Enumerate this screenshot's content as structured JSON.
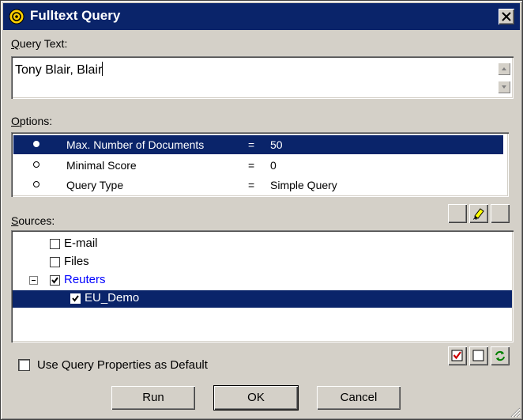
{
  "window": {
    "title": "Fulltext Query"
  },
  "query_text": {
    "label": "Query Text:",
    "value": "Tony Blair, Blair"
  },
  "options": {
    "label": "Options:",
    "rows": [
      {
        "name": "Max. Number of Documents",
        "eq": "=",
        "value": "50",
        "selected": true
      },
      {
        "name": "Minimal Score",
        "eq": "=",
        "value": "0",
        "selected": false
      },
      {
        "name": "Query Type",
        "eq": "=",
        "value": "Simple Query",
        "selected": false
      }
    ]
  },
  "sources": {
    "label": "Sources:",
    "items": [
      {
        "label": "E-mail",
        "checked": false
      },
      {
        "label": "Files",
        "checked": false
      },
      {
        "label": "Reuters",
        "checked": true,
        "expanded": true,
        "color": "#0000ff"
      },
      {
        "label": "EU_Demo",
        "checked": true,
        "selected": true
      }
    ]
  },
  "default_checkbox": {
    "label": "Use Query Properties as Default",
    "checked": false
  },
  "buttons": {
    "run": "Run",
    "ok": "OK",
    "cancel": "Cancel"
  },
  "colors": {
    "selection": "#0a246a",
    "titlebar": "#0a246a",
    "face": "#d4d0c8"
  }
}
